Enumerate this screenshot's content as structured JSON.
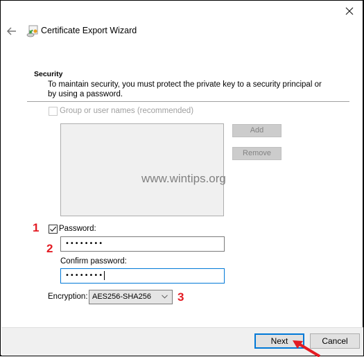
{
  "window": {
    "title": "Certificate Export Wizard",
    "close_icon": "close-icon",
    "back_icon": "back-arrow-icon",
    "wizard_icon": "certificate-export-icon"
  },
  "section": {
    "heading": "Security",
    "description": "To maintain security, you must protect the private key to a security principal or by using a password."
  },
  "group_option": {
    "label": "Group or user names (recommended)",
    "checked": false,
    "enabled": false,
    "add_label": "Add",
    "remove_label": "Remove",
    "items": []
  },
  "watermark": "www.wintips.org",
  "password": {
    "checkbox_label": "Password:",
    "checked": true,
    "value": "••••••••",
    "confirm_label": "Confirm password:",
    "confirm_value": "••••••••"
  },
  "encryption": {
    "label": "Encryption:",
    "selected": "AES256-SHA256"
  },
  "annotations": {
    "step1": "1",
    "step2": "2",
    "step3": "3",
    "color": "#e31b23"
  },
  "footer": {
    "next_label": "Next",
    "cancel_label": "Cancel"
  },
  "colors": {
    "accent": "#0078d7",
    "footer_bg": "#f0f0f0",
    "disabled_text": "#a0a0a0"
  }
}
